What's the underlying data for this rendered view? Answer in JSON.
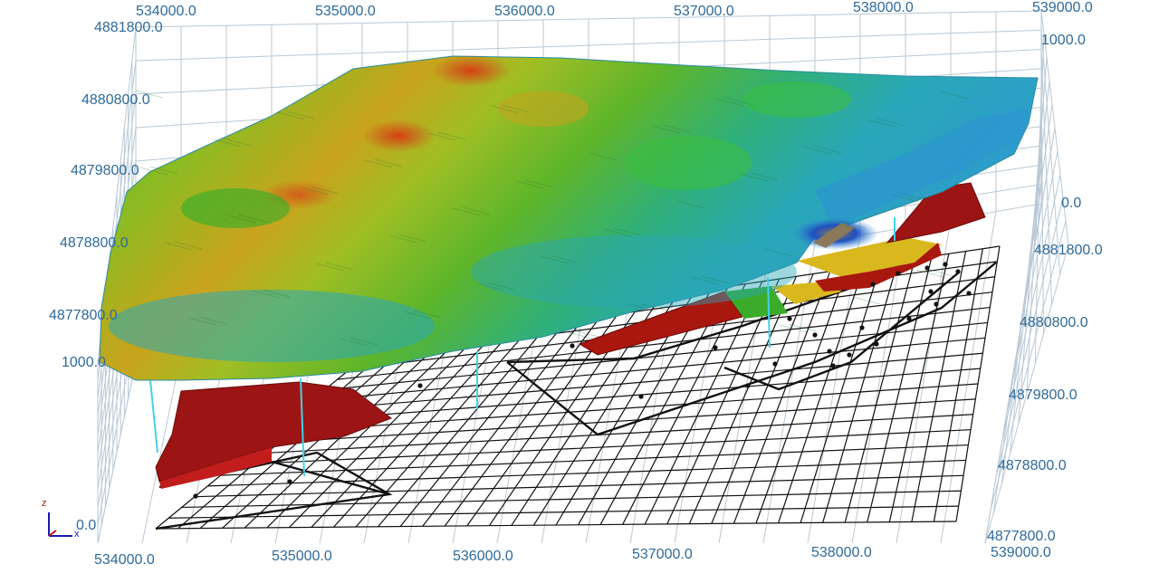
{
  "axes": {
    "x_top": [
      "534000.0",
      "535000.0",
      "536000.0",
      "537000.0",
      "538000.0",
      "539000.0"
    ],
    "x_bottom": [
      "534000.0",
      "535000.0",
      "536000.0",
      "537000.0",
      "538000.0",
      "539000.0"
    ],
    "y_left": [
      "4881800.0",
      "4880800.0",
      "4879800.0",
      "4878800.0",
      "4877800.0"
    ],
    "y_right": [
      "4881800.0",
      "4880800.0",
      "4879800.0",
      "4878800.0",
      "4877800.0"
    ],
    "z_left": [
      "1000.0",
      "0.0"
    ],
    "z_right": [
      "1000.0",
      "0.0"
    ]
  },
  "triad": {
    "z": "z",
    "x": "x"
  },
  "colors": {
    "label": "#2f6a9a",
    "grid": "#b9c8d6",
    "terrain_high": "#d4401a",
    "terrain_mid": "#8fbf1e",
    "terrain_low": "#2aa7b8",
    "terrain_deep": "#1f4fc0",
    "ore_body": "#9c1414",
    "ore_yellow": "#d9b81e",
    "drillhole": "#43d1e6",
    "mesh": "#111111"
  }
}
